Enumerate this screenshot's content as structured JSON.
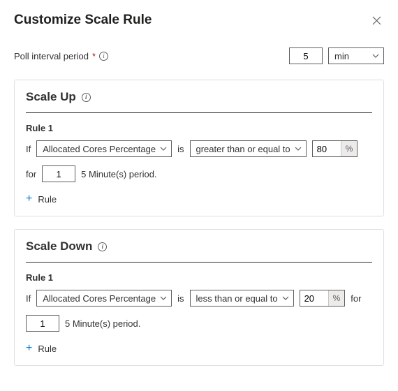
{
  "header": {
    "title": "Customize Scale Rule"
  },
  "poll": {
    "label": "Poll interval period",
    "value": "5",
    "unit": "min"
  },
  "scale_up": {
    "title": "Scale Up",
    "rule": {
      "title": "Rule 1",
      "if_label": "If",
      "metric": "Allocated Cores Percentage",
      "is_label": "is",
      "operator": "greater than or equal to",
      "threshold": "80",
      "pct_label": "%",
      "for_label": "for",
      "periods": "1",
      "period_text": "5 Minute(s) period."
    },
    "add_label": "Rule"
  },
  "scale_down": {
    "title": "Scale Down",
    "rule": {
      "title": "Rule 1",
      "if_label": "If",
      "metric": "Allocated Cores Percentage",
      "is_label": "is",
      "operator": "less than or equal to",
      "threshold": "20",
      "pct_label": "%",
      "for_label": "for",
      "periods": "1",
      "period_text": "5 Minute(s) period."
    },
    "add_label": "Rule"
  }
}
